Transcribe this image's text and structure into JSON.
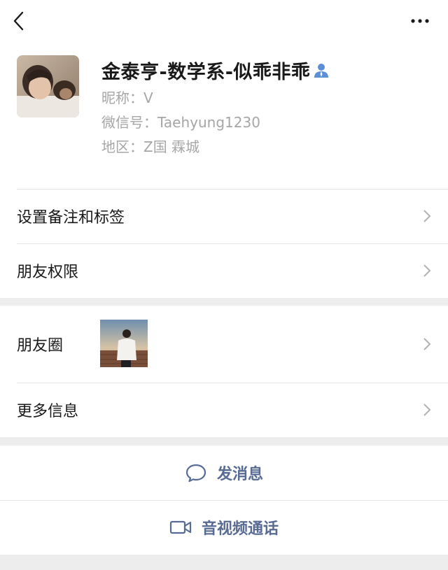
{
  "profile": {
    "display_name": "金泰亨-数学系-似乖非乖",
    "nickname_label": "昵称：",
    "nickname": "V",
    "wechat_id_label": "微信号：",
    "wechat_id": "Taehyung1230",
    "region_label": "地区：",
    "region": "Z国 霖城"
  },
  "menu": {
    "remark_tags": "设置备注和标签",
    "friend_permissions": "朋友权限",
    "moments": "朋友圈",
    "more_info": "更多信息"
  },
  "actions": {
    "send_message": "发消息",
    "video_call": "音视频通话"
  },
  "colors": {
    "accent_link": "#576b95",
    "secondary_text": "#a6a6a6",
    "contact_icon": "#5b8fd6"
  },
  "icons": [
    "back-chevron-icon",
    "more-dots-icon",
    "contact-person-icon",
    "chevron-right-icon",
    "chat-bubble-icon",
    "video-camera-icon"
  ]
}
